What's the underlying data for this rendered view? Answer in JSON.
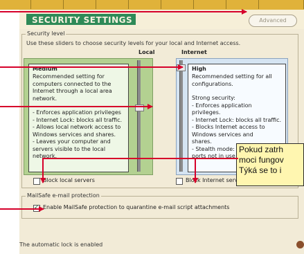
{
  "window": {
    "section_title": "SECURITY SETTINGS",
    "advanced_label": "Advanced"
  },
  "security_level": {
    "legend": "Security level",
    "description": "Use these sliders to choose security levels for your local and Internet access.",
    "local_heading": "Local",
    "internet_heading": "Internet",
    "local": {
      "level": "Medium",
      "summary": [
        "Recommended setting for",
        "computers connected to the",
        "Internet through a local area",
        "network."
      ],
      "bullets": [
        "- Enforces application privileges",
        "- Internet Lock: blocks all traffic.",
        "- Allows local network access to",
        "Windows services and shares.",
        "- Leaves your computer and",
        "servers visible to the local",
        "network."
      ]
    },
    "internet": {
      "level": "High",
      "summary": [
        "Recommended setting for all",
        "configurations."
      ],
      "strong": "Strong security:",
      "bullets": [
        "- Enforces application privileges.",
        "- Internet Lock: blocks all traffic.",
        "- Blocks Internet access to",
        "Windows services and",
        "shares.",
        "- Stealth mode: hides",
        "ports not in use by"
      ]
    },
    "block_local_label": "Block local servers",
    "block_internet_label": "Block Internet servers"
  },
  "mailsafe": {
    "legend": "MailSafe e-mail protection",
    "enable_label": "Enable MailSafe protection to quarantine e-mail script attachments",
    "enabled": true
  },
  "status_text": "The automatic lock is enabled",
  "tooltip": {
    "lines": [
      "Pokud zatrh",
      "moci fungov",
      "Týká se to i"
    ]
  },
  "colors": {
    "title_bar": "#2e8a57",
    "annotation": "#d6002a",
    "local_panel": "#b3d191",
    "internet_panel": "#d5e4f2"
  }
}
